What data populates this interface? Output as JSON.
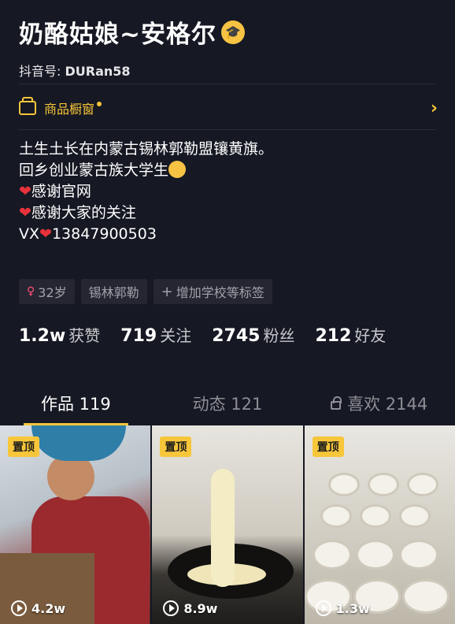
{
  "profile": {
    "name": "奶酪姑娘~安格尔",
    "douyin_id_label": "抖音号:",
    "douyin_id": "DURan58"
  },
  "shop": {
    "label": "商品橱窗"
  },
  "bio": {
    "line1": "土生土长在内蒙古锡林郭勒盟镶黄旗。",
    "line2": "回乡创业蒙古族大学生",
    "line3": "感谢官网",
    "line4": "感谢大家的关注",
    "line5_prefix": "VX",
    "line5_number": "13847900503"
  },
  "tags": {
    "age": "32岁",
    "location": "锡林郭勒",
    "add_school": "增加学校等标签"
  },
  "stats": [
    {
      "value": "1.2w",
      "label": "获赞"
    },
    {
      "value": "719",
      "label": "关注"
    },
    {
      "value": "2745",
      "label": "粉丝"
    },
    {
      "value": "212",
      "label": "好友"
    }
  ],
  "tabs": [
    {
      "label": "作品 119"
    },
    {
      "label": "动态 121"
    },
    {
      "label": "喜欢 2144"
    }
  ],
  "videos": [
    {
      "pin": "置顶",
      "plays": "4.2w"
    },
    {
      "pin": "置顶",
      "plays": "8.9w"
    },
    {
      "pin": "置顶",
      "plays": "1.3w"
    }
  ],
  "colors": {
    "background": "#161823",
    "accent": "#f7c63a",
    "heart": "#e8323c"
  },
  "icons": [
    "teacher-emoji-icon",
    "shop-icon",
    "chevron-right-icon",
    "heart-icon",
    "female-icon",
    "plus-icon",
    "lock-icon",
    "play-icon"
  ]
}
